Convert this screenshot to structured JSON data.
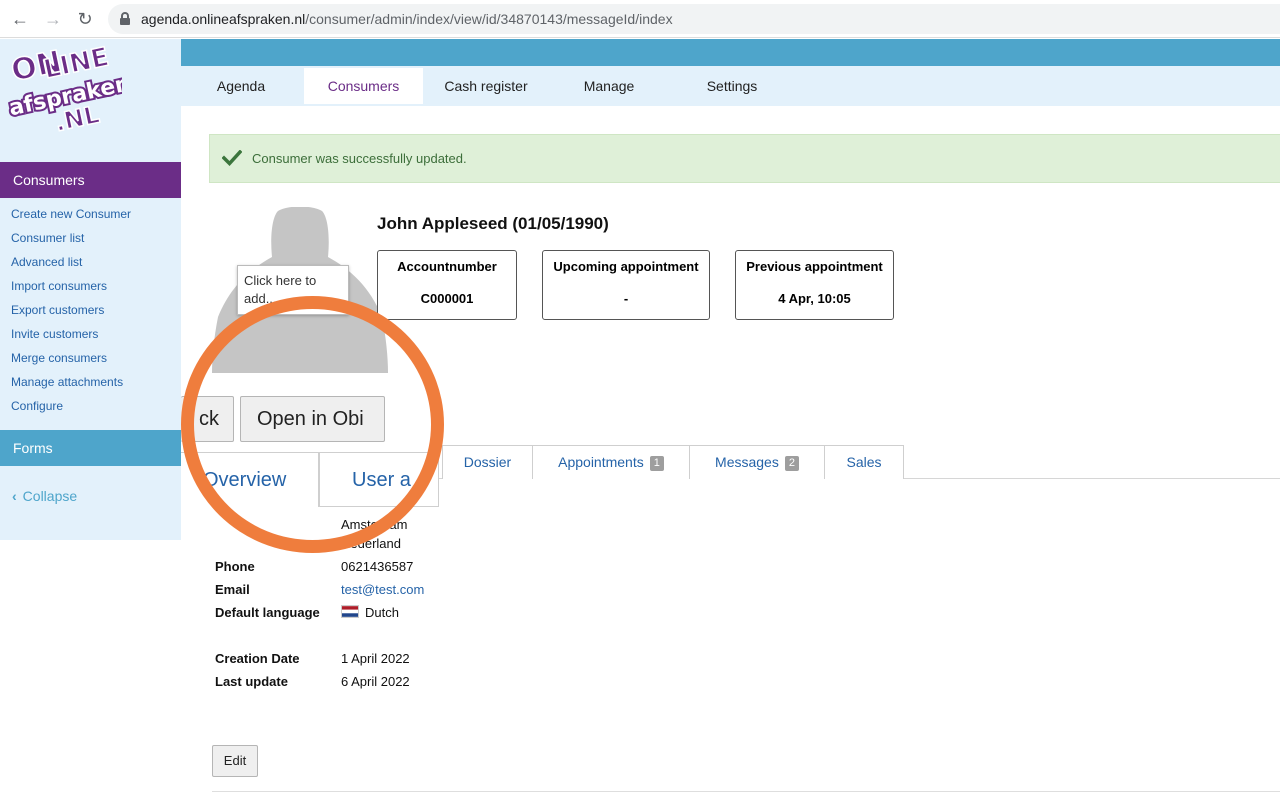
{
  "browser": {
    "url_domain": "agenda.onlineafspraken.nl",
    "url_path": "/consumer/admin/index/view/id/34870143/messageId/index"
  },
  "brand": {
    "logo_line1": "ON",
    "logo_line2": "LINE",
    "logo_line3": "afspraken",
    "logo_line4": ".NL"
  },
  "top_nav": [
    {
      "label": "Agenda"
    },
    {
      "label": "Consumers"
    },
    {
      "label": "Cash register"
    },
    {
      "label": "Manage"
    },
    {
      "label": "Settings"
    }
  ],
  "sidebar": {
    "section_title": "Consumers",
    "items": [
      {
        "label": "Create new Consumer"
      },
      {
        "label": "Consumer list"
      },
      {
        "label": "Advanced list"
      },
      {
        "label": "Import consumers"
      },
      {
        "label": "Export customers"
      },
      {
        "label": "Invite customers"
      },
      {
        "label": "Merge consumers"
      },
      {
        "label": "Manage attachments"
      },
      {
        "label": "Configure"
      }
    ],
    "forms_title": "Forms",
    "collapse_label": "Collapse"
  },
  "alert": {
    "message": "Consumer was successfully updated."
  },
  "avatar": {
    "tooltip": "Click here to add..."
  },
  "consumer": {
    "name": "John Appleseed (01/05/1990)",
    "cards": [
      {
        "label": "Accountnumber",
        "value": "C000001"
      },
      {
        "label": "Upcoming appointment",
        "value": "-"
      },
      {
        "label": "Previous appointment",
        "value": "4 Apr, 10:05"
      }
    ]
  },
  "actions": {
    "back_partial": "ck",
    "open_partial": "Open in Obi"
  },
  "tabs": {
    "overview_partial": "Overview",
    "user_partial": "User a",
    "items": [
      {
        "label": "Dossier"
      },
      {
        "label": "Appointments",
        "badge": "1"
      },
      {
        "label": "Messages",
        "badge": "2"
      },
      {
        "label": "Sales"
      }
    ]
  },
  "details": {
    "address_line1": "Amsterdam",
    "address_line2": "Nederland",
    "phone_label": "Phone",
    "phone_value": "0621436587",
    "email_label": "Email",
    "email_value": "test@test.com",
    "language_label": "Default language",
    "language_value": "Dutch",
    "creation_label": "Creation Date",
    "creation_value": "1 April 2022",
    "update_label": "Last update",
    "update_value": "6 April 2022"
  },
  "edit_label": "Edit",
  "colors": {
    "brand_purple": "#6b2d87",
    "brand_blue": "#4ea5cb",
    "highlight_orange": "#ef7d3d"
  }
}
